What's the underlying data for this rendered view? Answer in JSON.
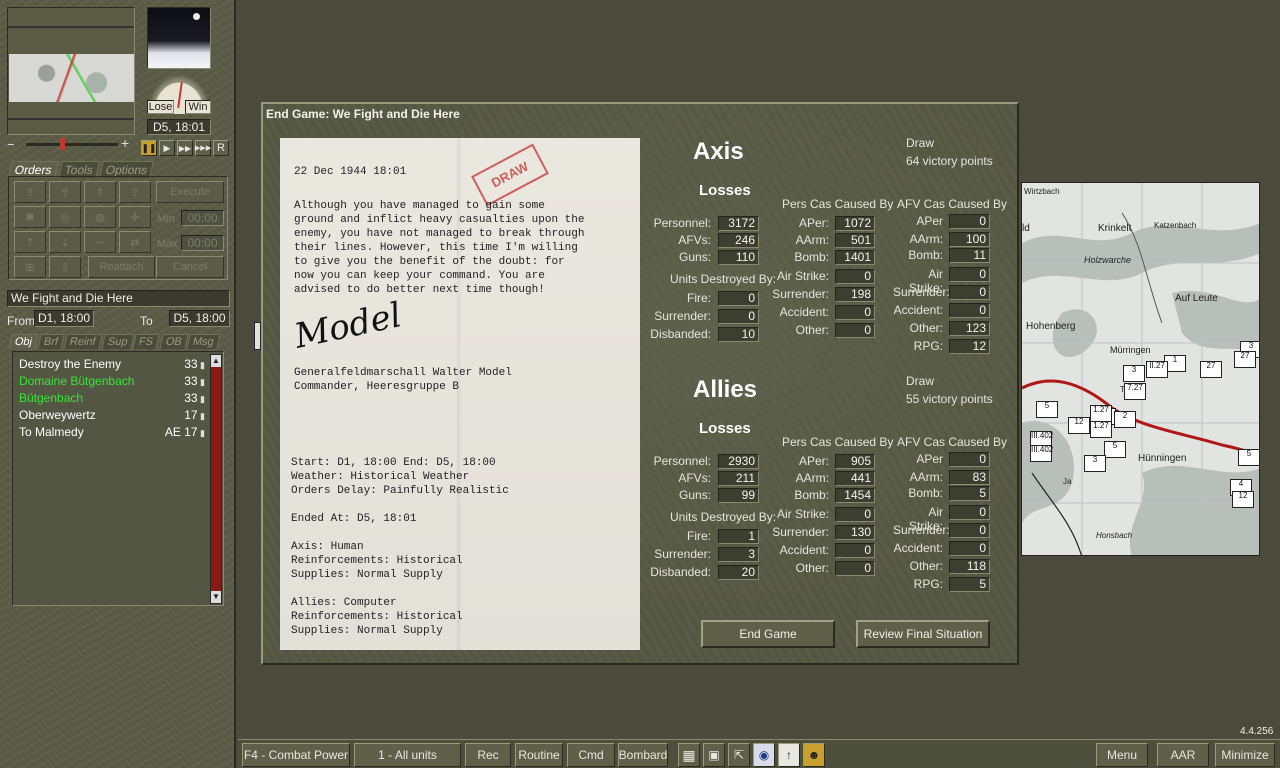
{
  "left_panel": {
    "turn_time": "D5, 18:01",
    "gauge": {
      "lose_label": "Lose",
      "win_label": "Win"
    },
    "playback": {
      "record_label": "R"
    },
    "tabs_top": [
      {
        "label": "Orders",
        "active": true
      },
      {
        "label": "Tools",
        "active": false
      },
      {
        "label": "Options",
        "active": false
      }
    ],
    "orders": {
      "execute_label": "Execute",
      "min_label": "Min",
      "min_value": "00:00",
      "max_label": "Max",
      "max_value": "00:00",
      "reattach_label": "Reattach",
      "cancel_label": "Cancel"
    },
    "scenario_name": "We Fight and Die Here",
    "from_label": "From",
    "from_value": "D1, 18:00",
    "to_label": "To",
    "to_value": "D5, 18:00",
    "tabs_bottom": [
      {
        "label": "Obj",
        "active": true
      },
      {
        "label": "Brf",
        "active": false
      },
      {
        "label": "Reinf",
        "active": false
      },
      {
        "label": "Sup",
        "active": false
      },
      {
        "label": "FS",
        "active": false
      },
      {
        "label": "OB",
        "active": false
      },
      {
        "label": "Msg",
        "active": false
      }
    ],
    "objectives": [
      {
        "name": "Destroy the Enemy",
        "value": "33",
        "color": "#ffffff"
      },
      {
        "name": "Domaine Bütgenbach",
        "value": "33",
        "color": "#33e633"
      },
      {
        "name": "Bütgenbach",
        "value": "33",
        "color": "#33e633"
      },
      {
        "name": "Oberweywertz",
        "value": "17",
        "color": "#ffffff"
      },
      {
        "name": "To Malmedy",
        "value": "AE 17",
        "color": "#ffffff"
      }
    ]
  },
  "dialog": {
    "title": "End Game: We Fight and Die Here",
    "letter": {
      "stamp": "DRAW",
      "date": "22 Dec 1944 18:01",
      "body": [
        "Although you have managed to gain some",
        "ground and inflict heavy casualties upon the",
        "enemy, you have not managed to break through",
        "their lines. However, this time I'm willing",
        "to give you the benefit of the doubt: for",
        "now you can keep your command. You are",
        "advised to do better next time though!"
      ],
      "signature": "Model",
      "signer": "Generalfeldmarschall Walter Model",
      "signer_title": "Commander, Heeresgruppe B",
      "details": [
        "Start: D1, 18:00 End: D5, 18:00",
        "Weather: Historical Weather",
        "Orders Delay: Painfully Realistic",
        "",
        "Ended At: D5, 18:01",
        "",
        "Axis: Human",
        "Reinforcements: Historical",
        "Supplies: Normal Supply",
        "",
        "Allies: Computer",
        "Reinforcements: Historical",
        "Supplies: Normal Supply"
      ]
    },
    "axis": {
      "name": "Axis",
      "result": "Draw",
      "points": "64 victory points",
      "losses_label": "Losses",
      "losses": {
        "Personnel": "3172",
        "AFVs": "246",
        "Guns": "110"
      },
      "units_destroyed_label": "Units Destroyed By:",
      "units_destroyed": {
        "Fire": "0",
        "Surrender": "0",
        "Disbanded": "10"
      },
      "pers_header": "Pers Cas Caused By",
      "pers": {
        "APer": "1072",
        "AArm": "501",
        "Bomb": "1401",
        "Air Strike": "0",
        "Surrender": "198",
        "Accident": "0",
        "Other": "0"
      },
      "afv_header": "AFV Cas Caused By",
      "afv": {
        "APer": "0",
        "AArm": "100",
        "Bomb": "11",
        "Air Strike": "0",
        "Surrender": "0",
        "Accident": "0",
        "Other": "123",
        "RPG": "12"
      }
    },
    "allies": {
      "name": "Allies",
      "result": "Draw",
      "points": "55 victory points",
      "losses_label": "Losses",
      "losses": {
        "Personnel": "2930",
        "AFVs": "211",
        "Guns": "99"
      },
      "units_destroyed_label": "Units Destroyed By:",
      "units_destroyed": {
        "Fire": "1",
        "Surrender": "3",
        "Disbanded": "20"
      },
      "pers_header": "Pers Cas Caused By",
      "pers": {
        "APer": "905",
        "AArm": "441",
        "Bomb": "1454",
        "Air Strike": "0",
        "Surrender": "130",
        "Accident": "0",
        "Other": "0"
      },
      "afv_header": "AFV Cas Caused By",
      "afv": {
        "APer": "0",
        "AArm": "83",
        "Bomb": "5",
        "Air Strike": "0",
        "Surrender": "0",
        "Accident": "0",
        "Other": "118",
        "RPG": "5"
      }
    },
    "end_game_label": "End Game",
    "review_label": "Review Final Situation"
  },
  "map": {
    "labels": [
      "Wirtzbach",
      "Krinkelt",
      "Katzenbach",
      "Holzwarche",
      "Auf Leute",
      "Hohenberg",
      "Mürringen",
      "Hünningen",
      "Honsbach",
      "Tie",
      "Ja",
      "ld"
    ],
    "counters": [
      "5",
      "2",
      "3",
      "7.27",
      "1",
      "II.27",
      "27",
      "3",
      "27",
      "III.402",
      "12",
      "1.27",
      "2",
      "III.402",
      "5",
      "5",
      "3",
      "4",
      "12",
      "1.27"
    ]
  },
  "version": "4.4.256",
  "bottom_bar": {
    "combat_power": "F4 - Combat Power",
    "all_units": "1 - All units",
    "rec": "Rec",
    "routine": "Routine",
    "cmd": "Cmd",
    "bombard": "Bombard",
    "icons": [
      "hex-grid-icon",
      "units-icon",
      "arrow-icon",
      "target-icon",
      "up-arrow-icon",
      "leader-icon"
    ],
    "menu": "Menu",
    "aar": "AAR",
    "minimize": "Minimize"
  }
}
